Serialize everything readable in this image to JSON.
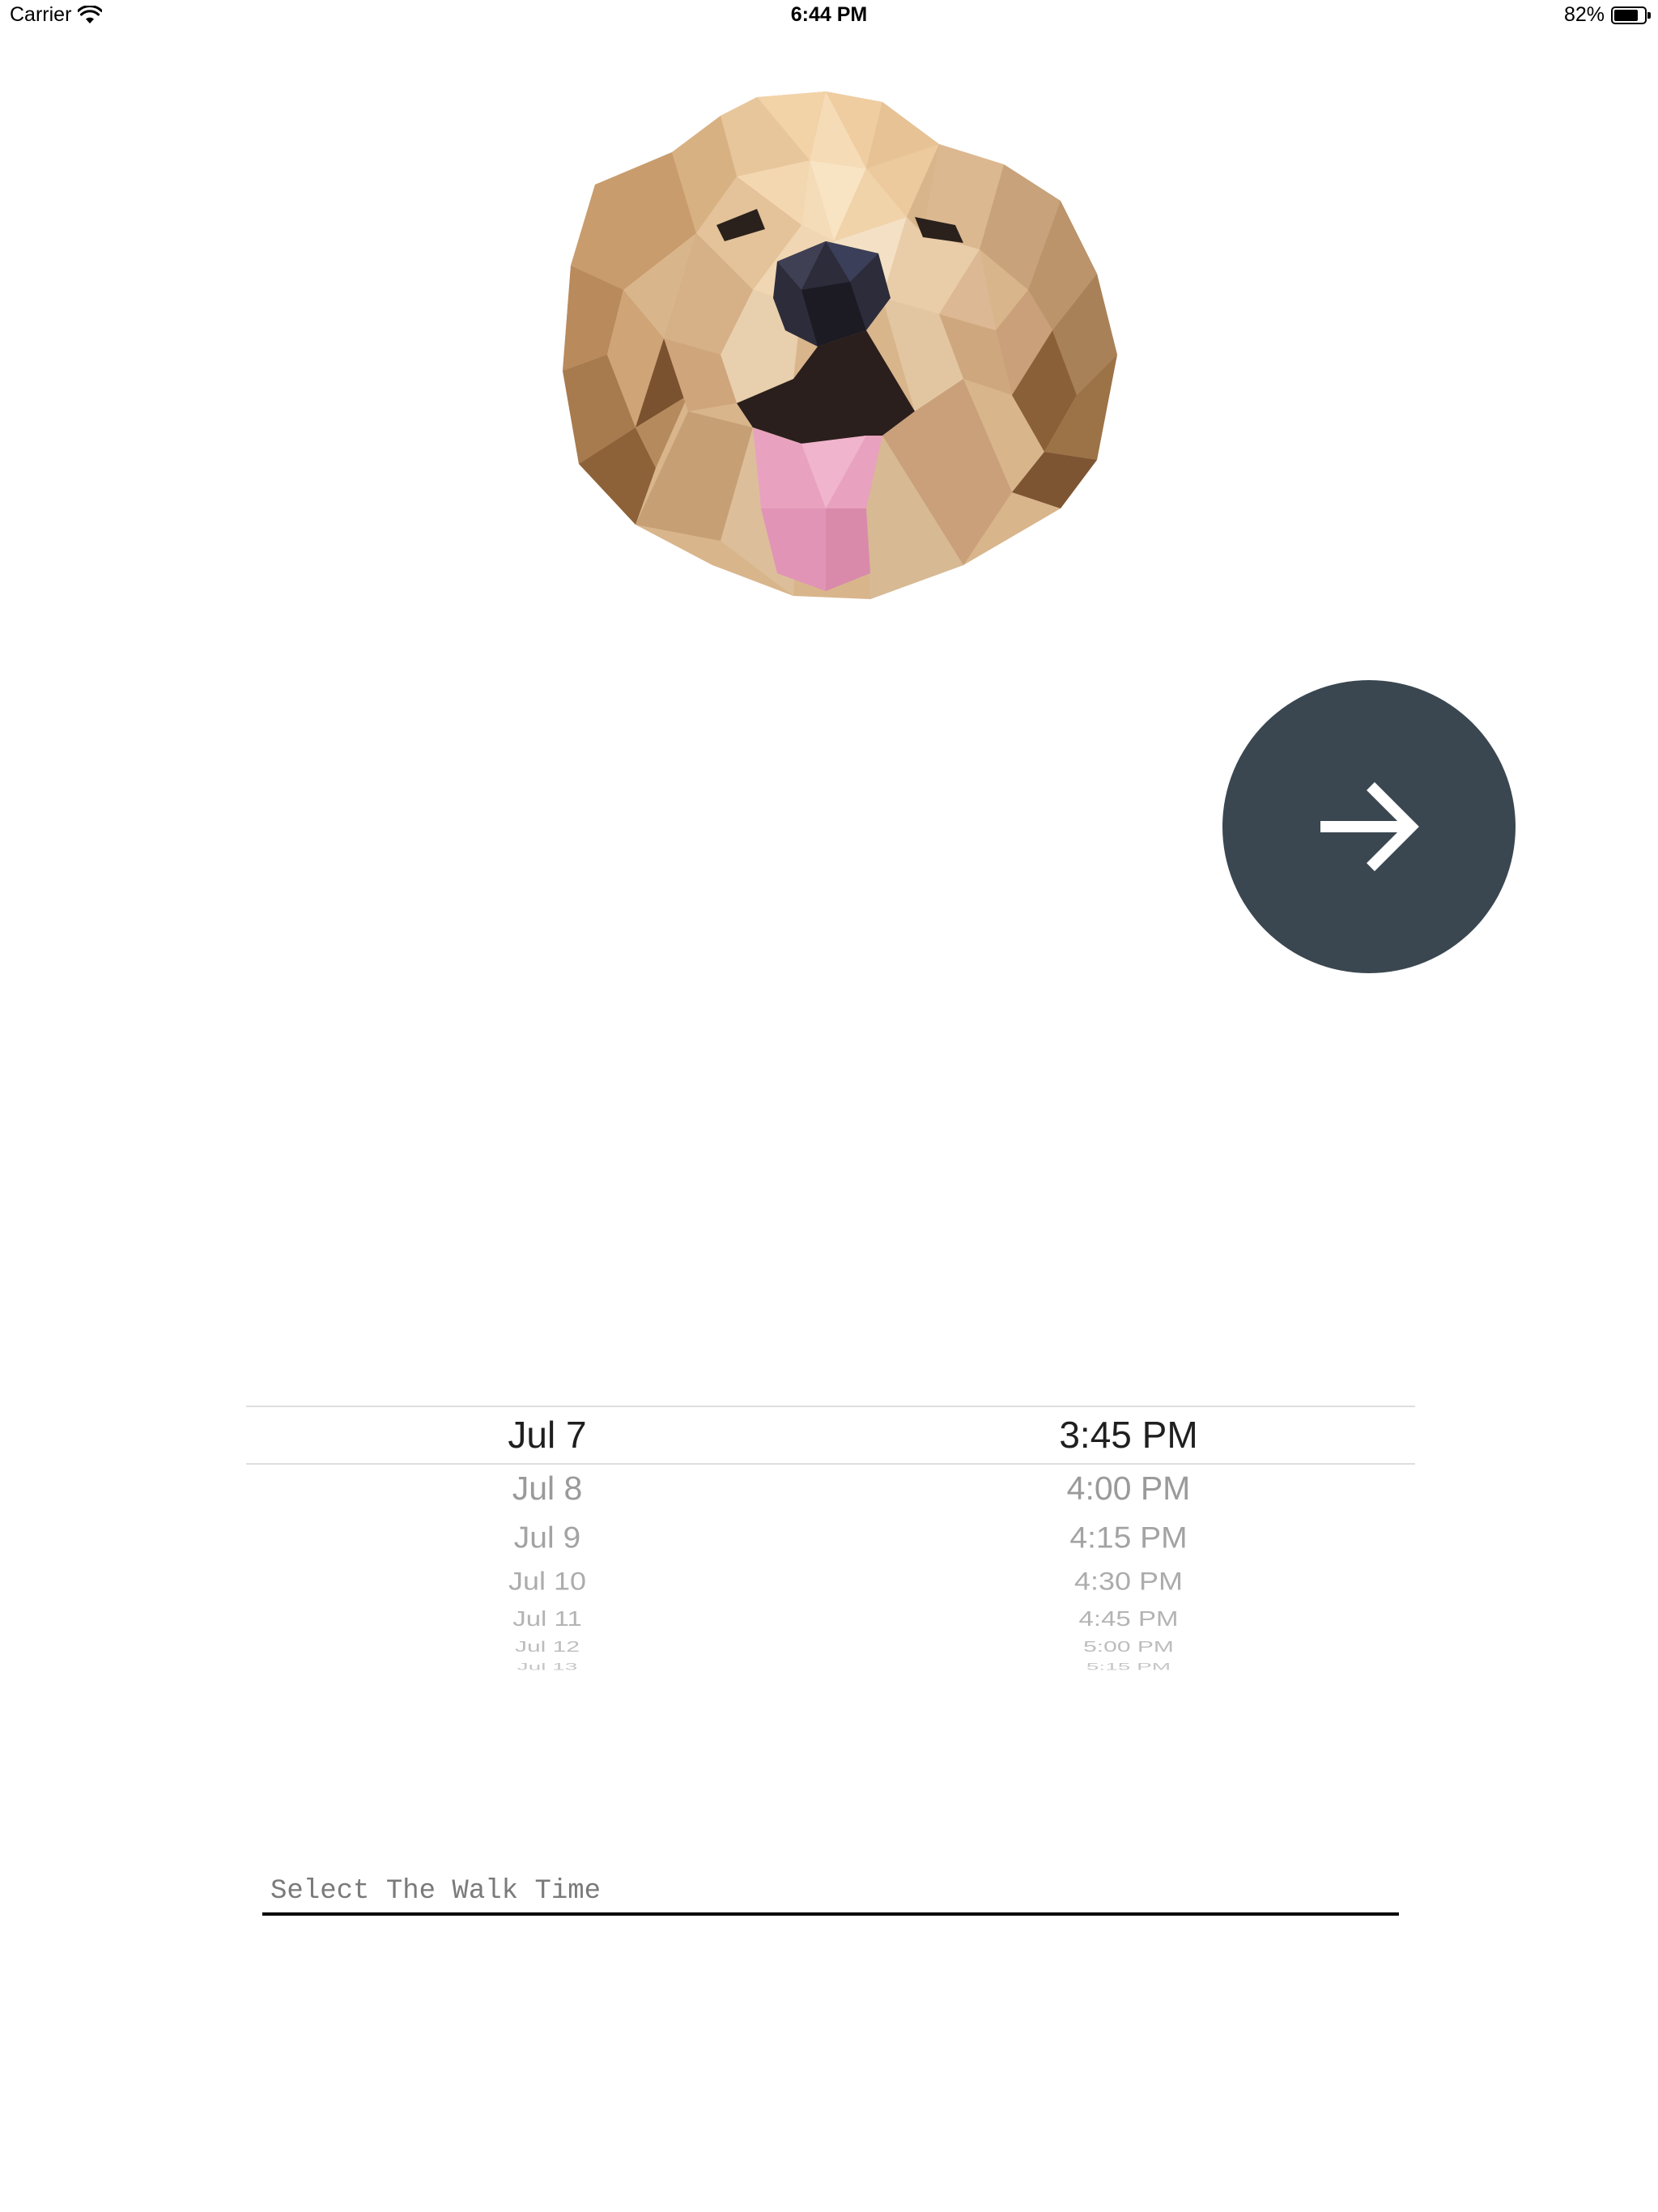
{
  "status_bar": {
    "carrier": "Carrier",
    "time": "6:44 PM",
    "battery_percent": "82%",
    "battery_level": 0.82,
    "wifi_icon": "wifi-icon",
    "battery_icon": "battery-icon"
  },
  "illustration": {
    "icon": "golden-retriever-low-poly",
    "colors": {
      "fur_light": "#f0d2a8",
      "fur_mid": "#d7b48a",
      "fur_dark": "#a97a4e",
      "fur_shadow": "#7b5230",
      "nose": "#2a2a35",
      "tongue": "#e8a2bf"
    }
  },
  "next_button": {
    "icon": "arrow-right-icon",
    "color": "#3a4750"
  },
  "picker": {
    "dates": [
      "Jul 7",
      "Jul 8",
      "Jul 9",
      "Jul 10",
      "Jul 11",
      "Jul 12",
      "Jul 13"
    ],
    "times": [
      "3:45 PM",
      "4:00 PM",
      "4:15 PM",
      "4:30 PM",
      "4:45 PM",
      "5:00 PM",
      "5:15 PM"
    ],
    "selected_date": "Jul 7",
    "selected_time": "3:45 PM"
  },
  "walk_time_field": {
    "placeholder": "Select The Walk Time",
    "value": ""
  }
}
